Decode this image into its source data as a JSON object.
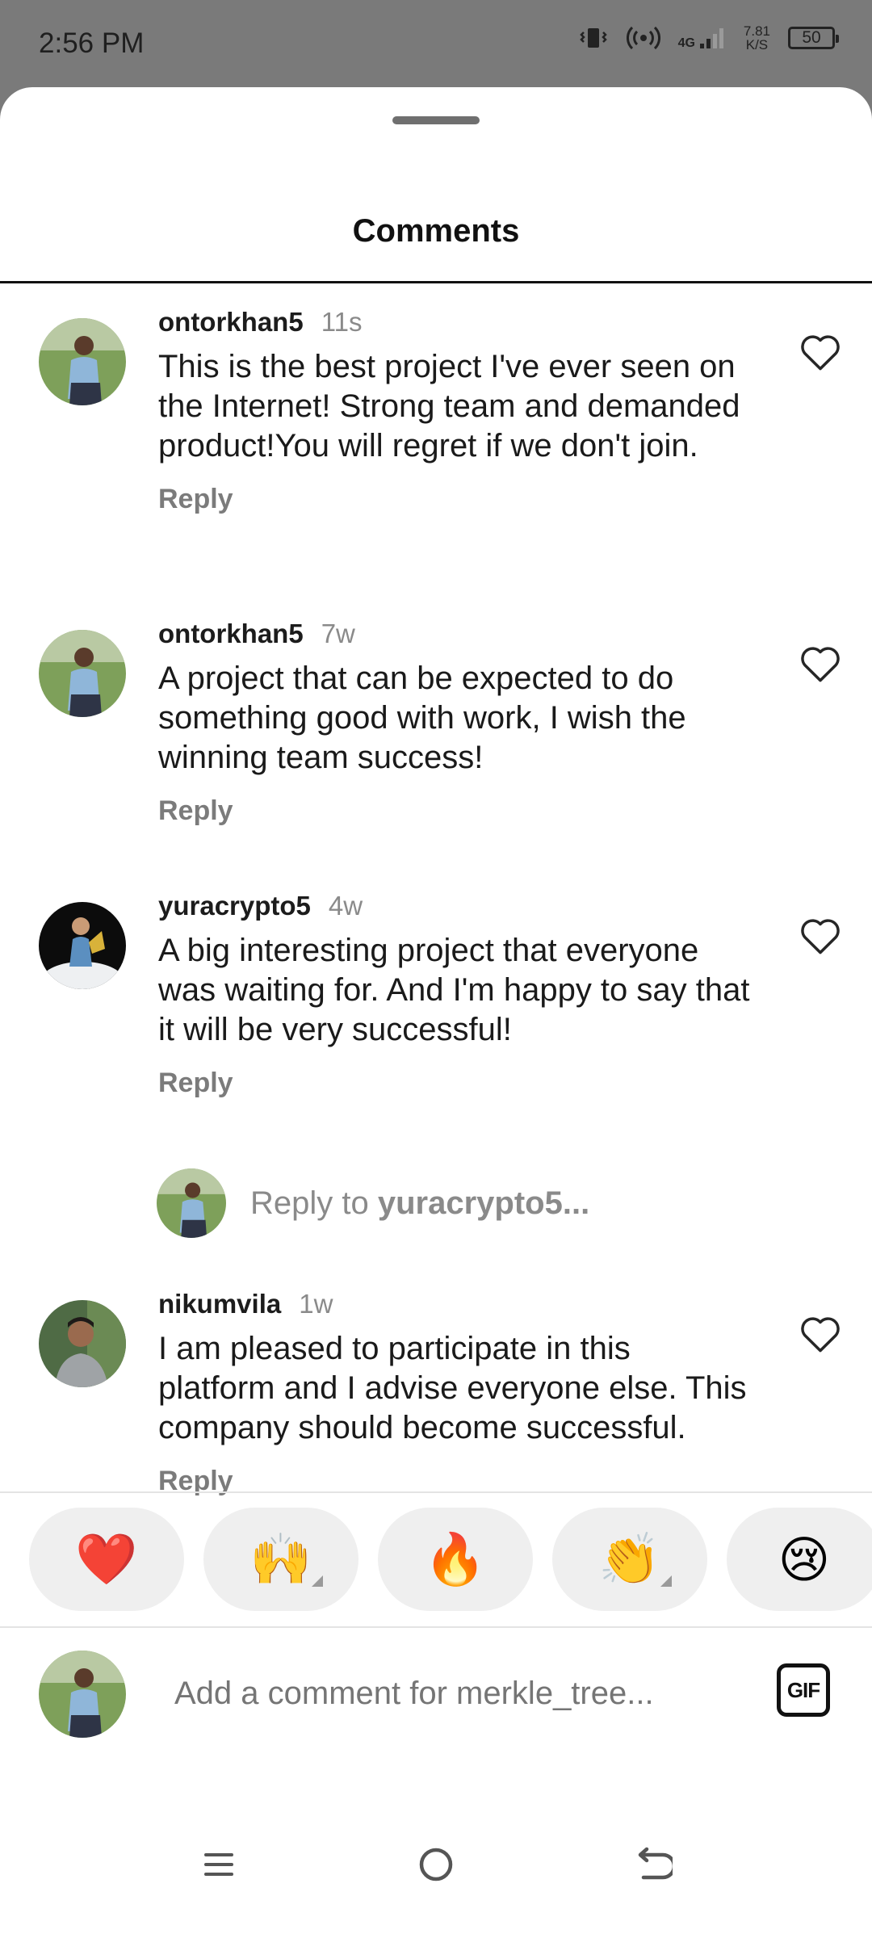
{
  "status_bar": {
    "time": "2:56 PM",
    "network": "4G",
    "speed_value": "7.81",
    "speed_unit": "K/S",
    "battery": "50"
  },
  "sheet": {
    "title": "Comments"
  },
  "comments": [
    {
      "username": "ontorkhan5",
      "time": "11s",
      "text": "This is the best project I've ever seen on the Internet! Strong team and demanded product!You will regret if we don't join.",
      "reply_label": "Reply",
      "avatar": "user-avatar-ontorkhan5"
    },
    {
      "username": "ontorkhan5",
      "time": "7w",
      "text": "A project that can be expected to do something good with work, I wish the winning team success!",
      "reply_label": "Reply",
      "avatar": "user-avatar-ontorkhan5"
    },
    {
      "username": "yuracrypto5",
      "time": "4w",
      "text": "A big interesting project that everyone was waiting for. And I'm happy to say that it will be very successful!",
      "reply_label": "Reply",
      "avatar": "user-avatar-yuracrypto5"
    },
    {
      "username": "nikumvila",
      "time": "1w",
      "text": "I am pleased to participate in this platform and I advise everyone else. This company should become successful.",
      "reply_label": "Reply",
      "avatar": "user-avatar-nikumvila"
    }
  ],
  "reply_prompt": {
    "prefix": "Reply to ",
    "username": "yuracrypto5..."
  },
  "reactions": [
    "❤️",
    "🙌",
    "🔥",
    "👏",
    "😢"
  ],
  "composer": {
    "placeholder": "Add a comment for merkle_tree...",
    "gif_label": "GIF"
  },
  "colors": {
    "heart_outline": "#262626",
    "muted_text": "#8a8a8a",
    "reaction_bg": "#efefef"
  }
}
